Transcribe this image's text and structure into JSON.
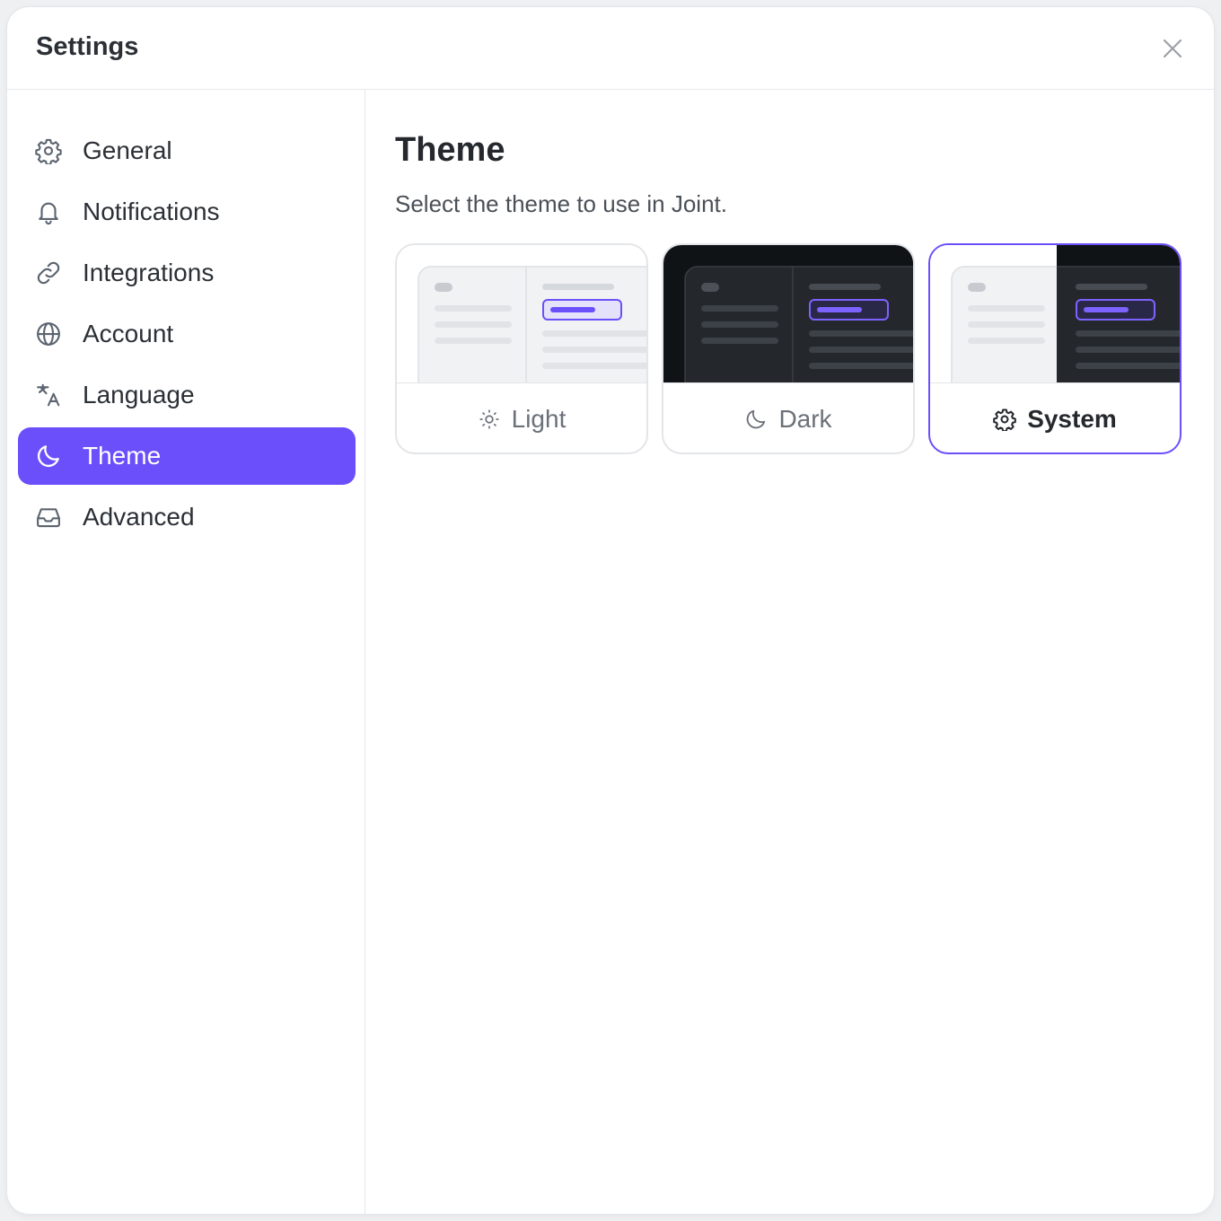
{
  "dialog": {
    "title": "Settings"
  },
  "sidebar": {
    "items": [
      {
        "id": "general",
        "label": "General",
        "icon": "gear-icon"
      },
      {
        "id": "notifications",
        "label": "Notifications",
        "icon": "bell-icon"
      },
      {
        "id": "integrations",
        "label": "Integrations",
        "icon": "link-icon"
      },
      {
        "id": "account",
        "label": "Account",
        "icon": "globe-icon"
      },
      {
        "id": "language",
        "label": "Language",
        "icon": "translate-icon"
      },
      {
        "id": "theme",
        "label": "Theme",
        "icon": "moon-icon",
        "active": true
      },
      {
        "id": "advanced",
        "label": "Advanced",
        "icon": "inbox-icon"
      }
    ]
  },
  "main": {
    "title": "Theme",
    "description": "Select the theme to use in Joint.",
    "options": [
      {
        "label": "Light",
        "icon": "sun-icon",
        "selected": false
      },
      {
        "label": "Dark",
        "icon": "moon-icon",
        "selected": false
      },
      {
        "label": "System",
        "icon": "gear-icon",
        "selected": true
      }
    ]
  },
  "colors": {
    "accent": "#6b4ffb",
    "light_preview_bg": "#f1f2f4",
    "dark_preview_bg": "#24272c",
    "dark_outer": "#101316"
  }
}
